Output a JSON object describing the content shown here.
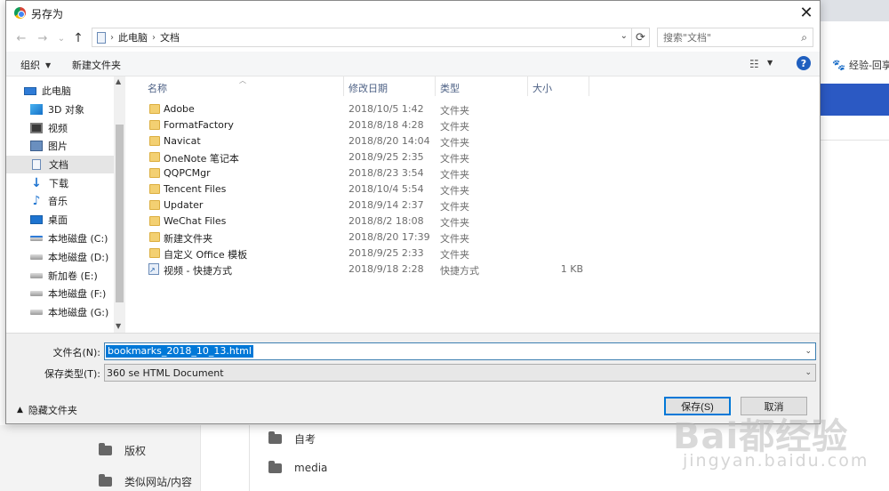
{
  "dialog": {
    "title": "另存为",
    "close_glyph": "✕"
  },
  "navbar": {
    "back_glyph": "←",
    "forward_glyph": "→",
    "recent_glyph": "⌄",
    "up_glyph": "↑",
    "breadcrumb": [
      "此电脑",
      "文档"
    ],
    "breadcrumb_sep": "›",
    "search_placeholder": "搜索\"文档\""
  },
  "toolbar": {
    "organize": "组织",
    "new_folder": "新建文件夹"
  },
  "nav_pane": {
    "items": [
      {
        "label": "此电脑",
        "icon": "computer-icon"
      },
      {
        "label": "3D 对象",
        "icon": "3d-objects-icon"
      },
      {
        "label": "视频",
        "icon": "video-icon"
      },
      {
        "label": "图片",
        "icon": "picture-icon"
      },
      {
        "label": "文档",
        "icon": "document-icon",
        "selected": true
      },
      {
        "label": "下载",
        "icon": "download-icon"
      },
      {
        "label": "音乐",
        "icon": "music-icon"
      },
      {
        "label": "桌面",
        "icon": "desktop-icon"
      },
      {
        "label": "本地磁盘 (C:)",
        "icon": "drive-c-icon"
      },
      {
        "label": "本地磁盘 (D:)",
        "icon": "drive-icon"
      },
      {
        "label": "新加卷 (E:)",
        "icon": "drive-icon"
      },
      {
        "label": "本地磁盘 (F:)",
        "icon": "drive-icon"
      },
      {
        "label": "本地磁盘 (G:)",
        "icon": "drive-icon"
      }
    ]
  },
  "file_list": {
    "columns": {
      "name": "名称",
      "date": "修改日期",
      "type": "类型",
      "size": "大小"
    },
    "rows": [
      {
        "name": "Adobe",
        "date": "2018/10/5 1:42",
        "type": "文件夹",
        "size": "",
        "icon": "folder-icon"
      },
      {
        "name": "FormatFactory",
        "date": "2018/8/18 4:28",
        "type": "文件夹",
        "size": "",
        "icon": "folder-icon"
      },
      {
        "name": "Navicat",
        "date": "2018/8/20 14:04",
        "type": "文件夹",
        "size": "",
        "icon": "folder-icon"
      },
      {
        "name": "OneNote 笔记本",
        "date": "2018/9/25 2:35",
        "type": "文件夹",
        "size": "",
        "icon": "folder-icon"
      },
      {
        "name": "QQPCMgr",
        "date": "2018/8/23 3:54",
        "type": "文件夹",
        "size": "",
        "icon": "folder-icon"
      },
      {
        "name": "Tencent Files",
        "date": "2018/10/4 5:54",
        "type": "文件夹",
        "size": "",
        "icon": "folder-icon"
      },
      {
        "name": "Updater",
        "date": "2018/9/14 2:37",
        "type": "文件夹",
        "size": "",
        "icon": "folder-icon"
      },
      {
        "name": "WeChat Files",
        "date": "2018/8/2 18:08",
        "type": "文件夹",
        "size": "",
        "icon": "folder-icon"
      },
      {
        "name": "新建文件夹",
        "date": "2018/8/20 17:39",
        "type": "文件夹",
        "size": "",
        "icon": "folder-icon"
      },
      {
        "name": "自定义 Office 模板",
        "date": "2018/9/25 2:33",
        "type": "文件夹",
        "size": "",
        "icon": "folder-icon"
      },
      {
        "name": "视频 - 快捷方式",
        "date": "2018/9/18 2:28",
        "type": "快捷方式",
        "size": "1 KB",
        "icon": "shortcut-icon"
      }
    ]
  },
  "form": {
    "filename_label": "文件名(N):",
    "filename_value": "bookmarks_2018_10_13.html",
    "filetype_label": "保存类型(T):",
    "filetype_value": "360 se HTML Document",
    "hide_folders": "隐藏文件夹",
    "save_button": "保存(S)",
    "cancel_button": "取消"
  },
  "background": {
    "bookmark_text": "经验-回享",
    "folder_items": [
      "自考",
      "media"
    ],
    "sidebar_items": [
      "版权",
      "类似网站/内容"
    ]
  },
  "watermark": {
    "logo": "Bai都经验",
    "url": "jingyan.baidu.com"
  }
}
